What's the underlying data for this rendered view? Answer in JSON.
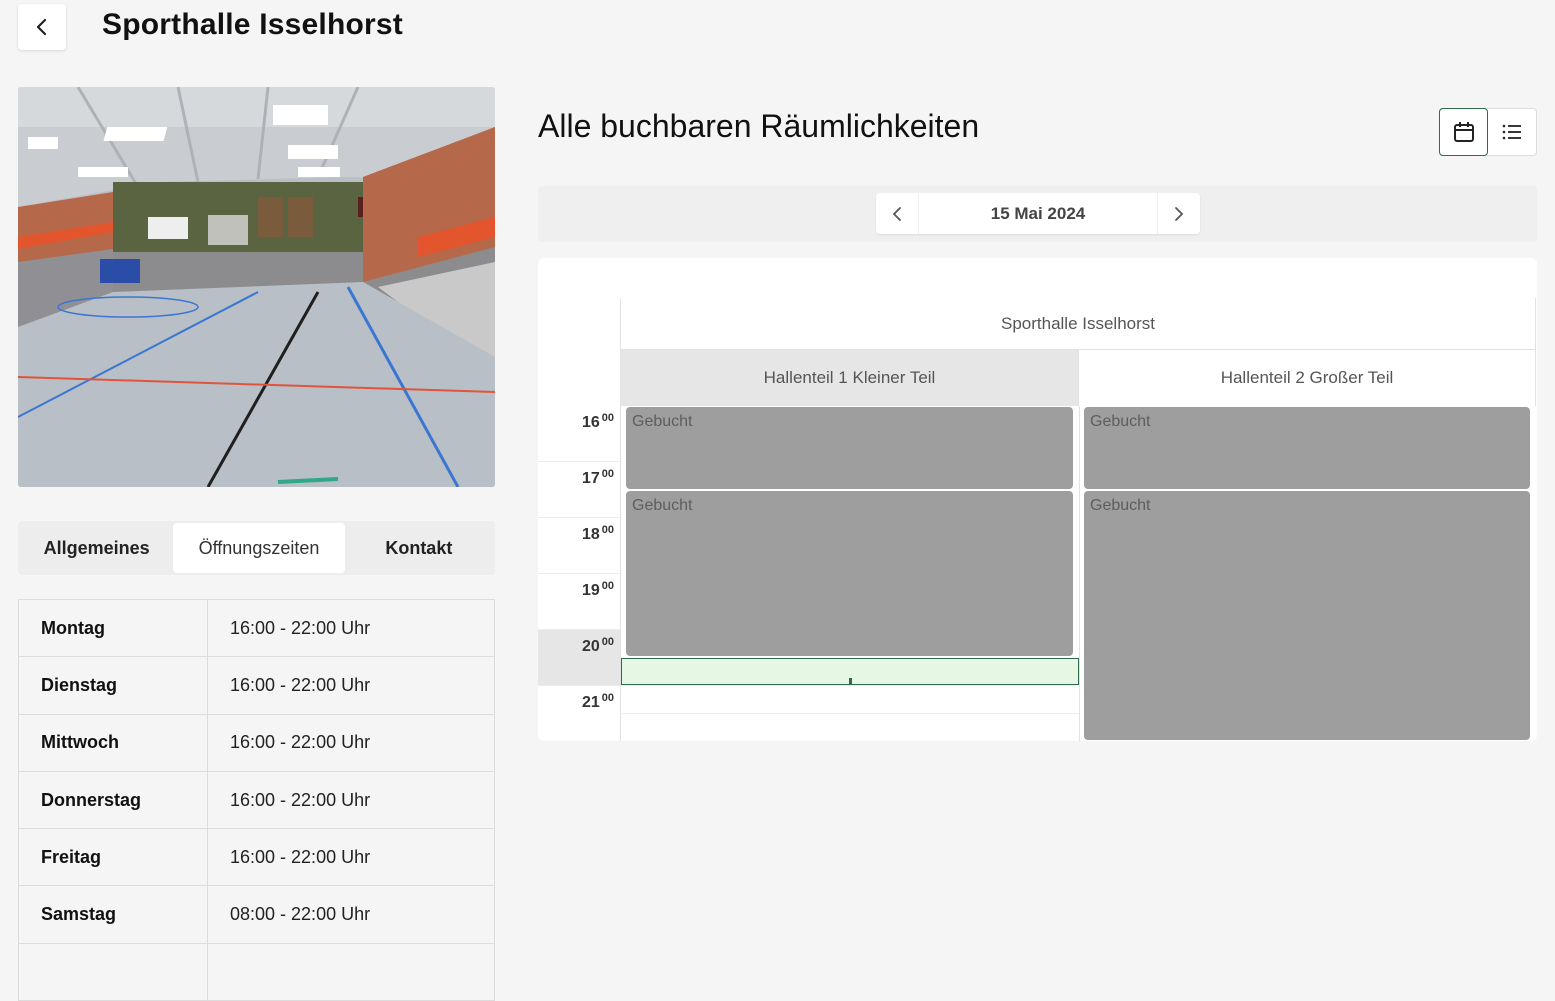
{
  "header": {
    "title": "Sporthalle Isselhorst",
    "back_icon": "chevron-left-icon"
  },
  "tabs": [
    {
      "label": "Allgemeines",
      "active": false
    },
    {
      "label": "Öffnungszeiten",
      "active": true
    },
    {
      "label": "Kontakt",
      "active": false
    }
  ],
  "opening_hours": [
    {
      "day": "Montag",
      "time": "16:00 - 22:00 Uhr"
    },
    {
      "day": "Dienstag",
      "time": "16:00 - 22:00 Uhr"
    },
    {
      "day": "Mittwoch",
      "time": "16:00 - 22:00 Uhr"
    },
    {
      "day": "Donnerstag",
      "time": "16:00 - 22:00 Uhr"
    },
    {
      "day": "Freitag",
      "time": "16:00 - 22:00 Uhr"
    },
    {
      "day": "Samstag",
      "time": "08:00 - 22:00 Uhr"
    }
  ],
  "rooms": {
    "title": "Alle buchbaren Räumlichkeiten",
    "view_modes": [
      "calendar-icon",
      "list-icon"
    ],
    "active_view": "calendar"
  },
  "date_nav": {
    "date": "15 Mai 2024"
  },
  "calendar": {
    "building": "Sporthalle Isselhorst",
    "resources": [
      "Hallenteil 1 Kleiner Teil",
      "Hallenteil 2 Großer Teil"
    ],
    "hours": [
      {
        "h": "16",
        "m": "00"
      },
      {
        "h": "17",
        "m": "00"
      },
      {
        "h": "18",
        "m": "00"
      },
      {
        "h": "19",
        "m": "00"
      },
      {
        "h": "20",
        "m": "00"
      },
      {
        "h": "21",
        "m": "00"
      }
    ],
    "events": [
      {
        "resource": 0,
        "label": "Gebucht",
        "start": "16:00",
        "end": "17:30"
      },
      {
        "resource": 0,
        "label": "Gebucht",
        "start": "17:30",
        "end": "20:30"
      },
      {
        "resource": 1,
        "label": "Gebucht",
        "start": "16:00",
        "end": "17:30"
      },
      {
        "resource": 1,
        "label": "Gebucht",
        "start": "17:30",
        "end": "22:00"
      }
    ],
    "highlighted_hour": "20",
    "selection": {
      "resource": 0,
      "start": "20:30",
      "end": "21:00"
    }
  },
  "colors": {
    "accent": "#2f6b4f",
    "booked": "#9e9e9e",
    "selection_fill": "#e6f7e6"
  }
}
